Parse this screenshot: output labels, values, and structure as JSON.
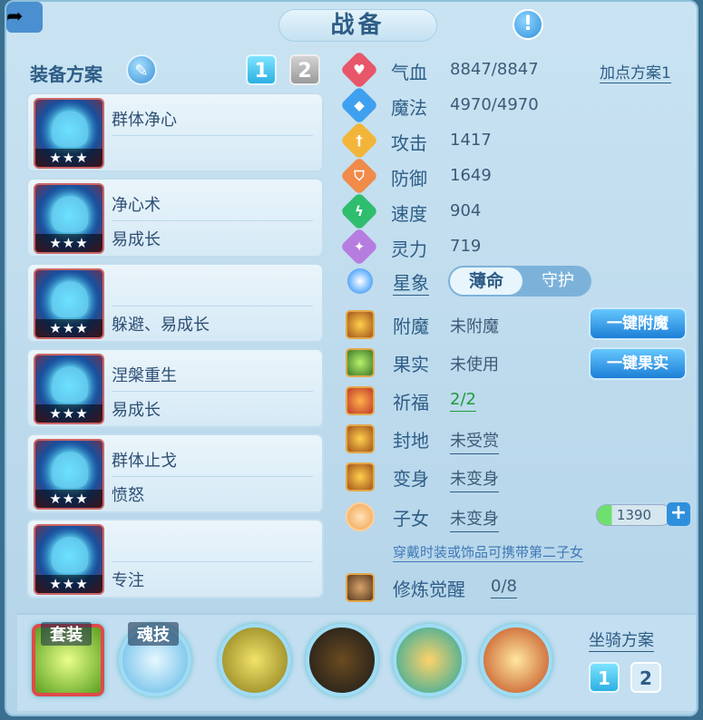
{
  "header": {
    "title": "战备",
    "help_icon": "exclamation-icon",
    "share_icon": "share-icon"
  },
  "equipment": {
    "plan_label": "装备方案",
    "plans": [
      "1",
      "2"
    ],
    "items": [
      {
        "name": "群体净心",
        "sub": "",
        "stars": "★★★"
      },
      {
        "name": "净心术",
        "sub": "易成长",
        "stars": "★★★"
      },
      {
        "name": "",
        "sub": "躲避、易成长",
        "stars": "★★★"
      },
      {
        "name": "涅槃重生",
        "sub": "易成长",
        "stars": "★★★"
      },
      {
        "name": "群体止戈",
        "sub": "愤怒",
        "stars": "★★★"
      },
      {
        "name": "",
        "sub": "专注",
        "stars": "★★★"
      }
    ]
  },
  "stats": {
    "addpoint_label": "加点方案1",
    "rows": [
      {
        "label": "气血",
        "value": "8847/8847",
        "color": "#e8566a"
      },
      {
        "label": "魔法",
        "value": "4970/4970",
        "color": "#3fa0f0"
      },
      {
        "label": "攻击",
        "value": "1417",
        "color": "#f2b53a"
      },
      {
        "label": "防御",
        "value": "1649",
        "color": "#f08b4a"
      },
      {
        "label": "速度",
        "value": "904",
        "color": "#2fbd6e"
      },
      {
        "label": "灵力",
        "value": "719",
        "color": "#b77ce0"
      }
    ]
  },
  "star": {
    "label": "星象",
    "options": [
      "薄命",
      "守护"
    ]
  },
  "features": [
    {
      "label": "附魔",
      "value": "未附魔",
      "button": "一键附魔"
    },
    {
      "label": "果实",
      "value": "未使用",
      "button": "一键果实"
    },
    {
      "label": "祈福",
      "value": "2/2"
    },
    {
      "label": "封地",
      "value": "未受赏"
    },
    {
      "label": "变身",
      "value": "未变身"
    },
    {
      "label": "子女",
      "value": "未变身",
      "bar_value": "1390"
    },
    {
      "label": "修炼觉醒",
      "value": "0/8"
    }
  ],
  "child_note": "穿戴时装或饰品可携带第二子女",
  "bottom": {
    "suit_label": "套装",
    "soul_label": "魂技",
    "mount_label": "坐骑方案",
    "mount_plans": [
      "1",
      "2"
    ]
  }
}
